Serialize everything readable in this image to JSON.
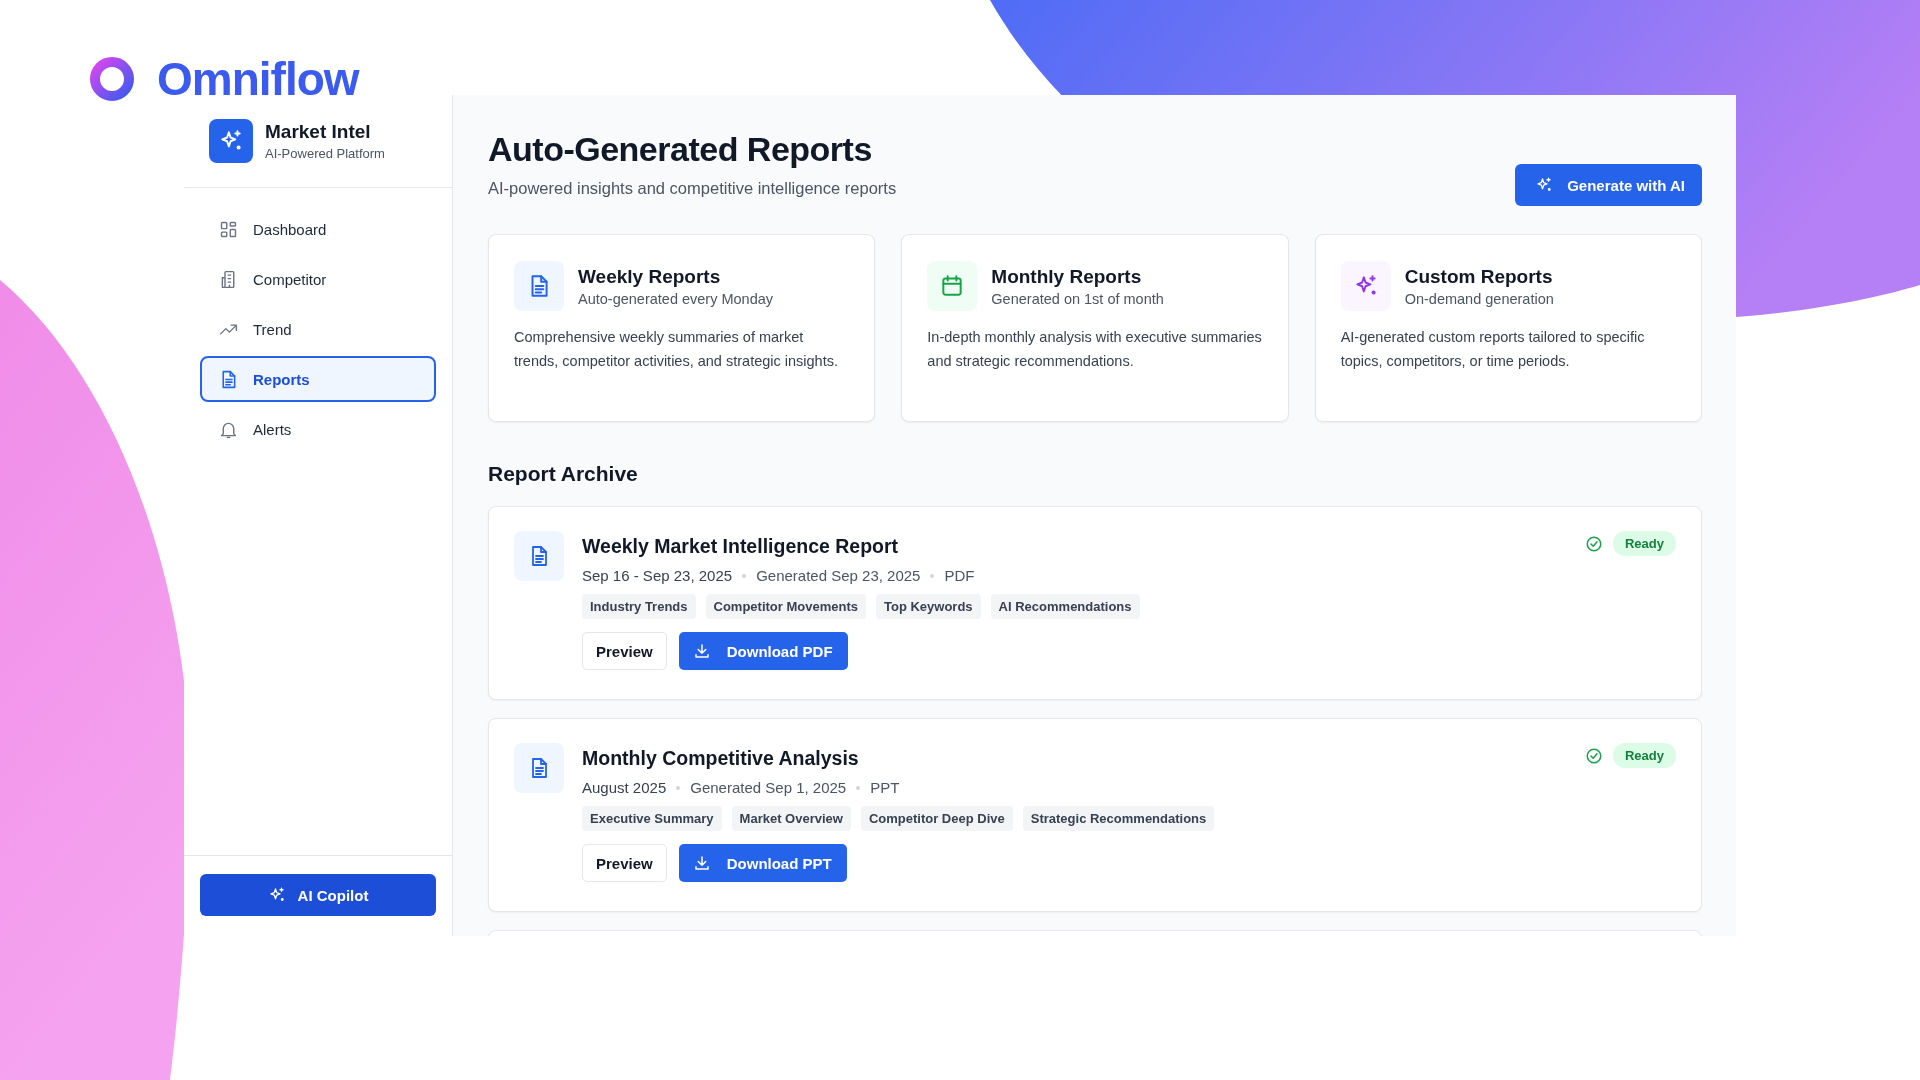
{
  "brand": {
    "name": "Omniflow"
  },
  "sidebar": {
    "title": "Market Intel",
    "subtitle": "AI-Powered Platform",
    "items": [
      {
        "label": "Dashboard",
        "kind": "grid",
        "selected": false
      },
      {
        "label": "Competitor",
        "kind": "building",
        "selected": false
      },
      {
        "label": "Trend",
        "kind": "trend",
        "selected": false
      },
      {
        "label": "Reports",
        "kind": "document",
        "selected": true
      },
      {
        "label": "Alerts",
        "kind": "bell",
        "selected": false
      }
    ],
    "copilot_button": "AI Copilot"
  },
  "main": {
    "title": "Auto-Generated Reports",
    "subtitle": "AI-powered insights and competitive intelligence reports",
    "generate_button": "Generate with AI",
    "summary_cards": [
      {
        "kind": "weekly",
        "title": "Weekly Reports",
        "subtitle": "Auto-generated every Monday",
        "description": "Comprehensive weekly summaries of market trends, competitor activities, and strategic insights."
      },
      {
        "kind": "monthly",
        "title": "Monthly Reports",
        "subtitle": "Generated on 1st of month",
        "description": "In-depth monthly analysis with executive summaries and strategic recommendations."
      },
      {
        "kind": "custom",
        "title": "Custom Reports",
        "subtitle": "On-demand generation",
        "description": "AI-generated custom reports tailored to specific topics, competitors, or time periods."
      }
    ],
    "archive_title": "Report Archive",
    "reports": [
      {
        "title": "Weekly Market Intelligence Report",
        "period": "Sep 16 - Sep 23, 2025",
        "generated": "Generated Sep 23, 2025",
        "format": "PDF",
        "status": "Ready",
        "tags": [
          "Industry Trends",
          "Competitor Movements",
          "Top Keywords",
          "AI Recommendations"
        ],
        "preview_button": "Preview",
        "download_button": "Download PDF"
      },
      {
        "title": "Monthly Competitive Analysis",
        "period": "August 2025",
        "generated": "Generated Sep 1, 2025",
        "format": "PPT",
        "status": "Ready",
        "tags": [
          "Executive Summary",
          "Market Overview",
          "Competitor Deep Dive",
          "Strategic Recommendations"
        ],
        "preview_button": "Preview",
        "download_button": "Download PPT"
      }
    ]
  }
}
